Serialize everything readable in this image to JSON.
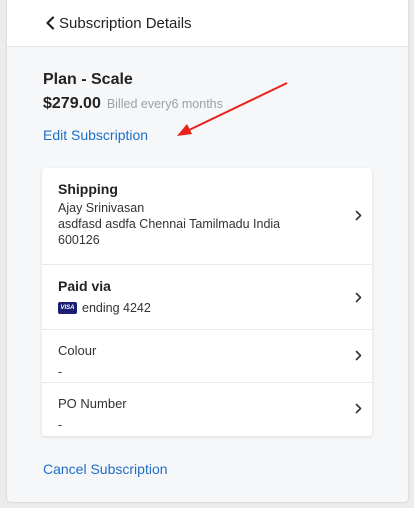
{
  "header": {
    "back_icon": "chevron-left-icon",
    "title": "Subscription Details"
  },
  "plan": {
    "name": "Plan - Scale",
    "price": "$279.00",
    "billing": "Billed every6 months",
    "edit_label": "Edit Subscription"
  },
  "details": {
    "shipping": {
      "title": "Shipping",
      "name": "Ajay Srinivasan",
      "address_line": "asdfasd asdfa Chennai Tamilmadu India",
      "postcode": "600126"
    },
    "paid_via": {
      "title": "Paid via",
      "card_brand": "VISA",
      "card_text": "ending 4242"
    },
    "colour": {
      "title": "Colour",
      "value": "-"
    },
    "po_number": {
      "title": "PO Number",
      "value": "-"
    }
  },
  "cancel_label": "Cancel Subscription",
  "colors": {
    "link": "#1d6fc6",
    "annotation_arrow": "#e8231e",
    "visa": "#1a1f71"
  }
}
